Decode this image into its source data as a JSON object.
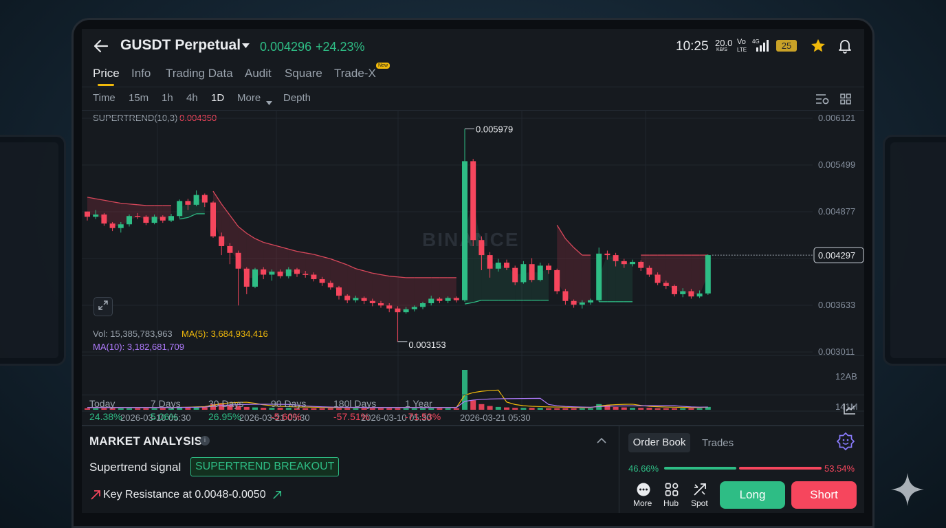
{
  "header": {
    "back_icon": "arrow-left-icon",
    "symbol": "GUSDT Perpetual",
    "price": "0.004296",
    "change": "+24.23%"
  },
  "status_bar": {
    "time": "10:25",
    "net_speed": "20.0",
    "net_unit": "KB/S",
    "volte_top": "Vo",
    "volte_bottom": "LTE",
    "signal": "4G",
    "battery": "25"
  },
  "tabs": [
    {
      "label": "Price",
      "active": true
    },
    {
      "label": "Info"
    },
    {
      "label": "Trading Data"
    },
    {
      "label": "Audit"
    },
    {
      "label": "Square"
    },
    {
      "label": "Trade-X",
      "badge": "New"
    }
  ],
  "intervals": {
    "items": [
      "Time",
      "15m",
      "1h",
      "4h",
      "1D",
      "More",
      "Depth"
    ],
    "active": "1D"
  },
  "indicator": {
    "name": "SUPERTREND(10,3)",
    "value": "0.004350"
  },
  "watermark": "BINANCE",
  "price_axis": [
    "0.006121",
    "0.005499",
    "0.004877",
    "0.004297",
    "0.003633",
    "0.003011"
  ],
  "current_price_label": "0.004297",
  "high_label": "0.005979",
  "low_label": "0.003153",
  "volume": {
    "vol_label": "Vol: 15,385,783,963",
    "ma5_label": "MA(5): 3,684,934,416",
    "ma10_label": "MA(10): 3,182,681,709",
    "axis": [
      "12AB",
      "141M"
    ]
  },
  "date_axis": [
    "2026-03-10 05:30",
    "2026-03-21 05:30",
    "2026-03-10 05:30",
    "2026-03-21 05:30"
  ],
  "performance": [
    {
      "label": "Today",
      "value": "24.38%",
      "dir": "up"
    },
    {
      "label": "7 Days",
      "value": "5.06%",
      "dir": "up"
    },
    {
      "label": "30 Days",
      "value": "26.95%",
      "dir": "up"
    },
    {
      "label": "90 Days",
      "value": "-5.60%",
      "dir": "down"
    },
    {
      "label": "180l Days",
      "value": "-57.51%",
      "dir": "down"
    },
    {
      "label": "1 Year",
      "value": "-71.53%",
      "dir": "down"
    }
  ],
  "market_analysis": {
    "title": "MARKET ANALYSIS",
    "signal_label": "Supertrend signal",
    "signal_badge": "SUPERTREND BREAKOUT",
    "resistance": "Key Resistance at 0.0048-0.0050"
  },
  "order_panel": {
    "tab_orderbook": "Order Book",
    "tab_trades": "Trades",
    "buy_pct": "46.66%",
    "sell_pct": "53.54%",
    "buy_ratio": 0.4666
  },
  "bottom_nav": {
    "more": "More",
    "hub": "Hub",
    "spot": "Spot",
    "long": "Long",
    "short": "Short"
  },
  "colors": {
    "up": "#2ebd85",
    "down": "#f6465d",
    "accent": "#f0b90b",
    "ma5": "#f0b90b",
    "ma10": "#b17cff"
  },
  "chart_data": {
    "type": "candlestick",
    "indicator": "SUPERTREND(10,3)",
    "ylim": [
      0.003011,
      0.006121
    ],
    "candles": [
      [
        0.00488,
        0.00481,
        0.00488,
        0.00476
      ],
      [
        0.00481,
        0.00484,
        0.0049,
        0.00478
      ],
      [
        0.00484,
        0.00472,
        0.00486,
        0.00469
      ],
      [
        0.00472,
        0.00466,
        0.00474,
        0.00462
      ],
      [
        0.00466,
        0.00471,
        0.00474,
        0.0046
      ],
      [
        0.00471,
        0.00482,
        0.00484,
        0.00468
      ],
      [
        0.00482,
        0.00481,
        0.00486,
        0.00478
      ],
      [
        0.00481,
        0.00473,
        0.00483,
        0.0047
      ],
      [
        0.00473,
        0.00481,
        0.00484,
        0.00471
      ],
      [
        0.00481,
        0.00476,
        0.00483,
        0.00473
      ],
      [
        0.00476,
        0.00482,
        0.00485,
        0.00474
      ],
      [
        0.00482,
        0.00502,
        0.00504,
        0.00479
      ],
      [
        0.00502,
        0.00497,
        0.00505,
        0.0049
      ],
      [
        0.00497,
        0.0051,
        0.00516,
        0.00495
      ],
      [
        0.0051,
        0.005,
        0.00512,
        0.00494
      ],
      [
        0.005,
        0.00455,
        0.00502,
        0.00453
      ],
      [
        0.00455,
        0.00442,
        0.0046,
        0.0043
      ],
      [
        0.00442,
        0.00433,
        0.00446,
        0.00418
      ],
      [
        0.00433,
        0.00412,
        0.00436,
        0.00363
      ],
      [
        0.00412,
        0.00388,
        0.00414,
        0.00378
      ],
      [
        0.00388,
        0.00411,
        0.00413,
        0.00386
      ],
      [
        0.00411,
        0.00404,
        0.00414,
        0.00398
      ],
      [
        0.00404,
        0.00408,
        0.00411,
        0.00396
      ],
      [
        0.00408,
        0.00402,
        0.00411,
        0.00399
      ],
      [
        0.00402,
        0.00411,
        0.00414,
        0.00399
      ],
      [
        0.00411,
        0.00405,
        0.00413,
        0.00401
      ],
      [
        0.00405,
        0.00404,
        0.00409,
        0.004
      ],
      [
        0.00404,
        0.00398,
        0.00407,
        0.00395
      ],
      [
        0.00398,
        0.00393,
        0.00401,
        0.00389
      ],
      [
        0.00393,
        0.00387,
        0.00396,
        0.00384
      ],
      [
        0.00387,
        0.00376,
        0.00389,
        0.00371
      ],
      [
        0.00376,
        0.0037,
        0.00378,
        0.00366
      ],
      [
        0.0037,
        0.00373,
        0.00376,
        0.00367
      ],
      [
        0.00373,
        0.00369,
        0.00375,
        0.00365
      ],
      [
        0.00369,
        0.00366,
        0.00372,
        0.00362
      ],
      [
        0.00366,
        0.00363,
        0.00369,
        0.0036
      ],
      [
        0.00363,
        0.00359,
        0.00366,
        0.00354
      ],
      [
        0.00359,
        0.00354,
        0.00362,
        0.00315
      ],
      [
        0.00354,
        0.00358,
        0.00361,
        0.00352
      ],
      [
        0.00358,
        0.00361,
        0.00363,
        0.00355
      ],
      [
        0.00361,
        0.00366,
        0.00368,
        0.00358
      ],
      [
        0.00366,
        0.00372,
        0.00376,
        0.00363
      ],
      [
        0.00372,
        0.00369,
        0.00374,
        0.00366
      ],
      [
        0.00369,
        0.00373,
        0.00375,
        0.00366
      ],
      [
        0.00373,
        0.0037,
        0.00375,
        0.00367
      ],
      [
        0.0037,
        0.00555,
        0.00598,
        0.00368
      ],
      [
        0.00555,
        0.0045,
        0.00558,
        0.00442
      ],
      [
        0.0045,
        0.0043,
        0.00455,
        0.0041
      ],
      [
        0.0043,
        0.00412,
        0.00434,
        0.004
      ],
      [
        0.00412,
        0.0042,
        0.00425,
        0.00408
      ],
      [
        0.0042,
        0.00413,
        0.00424,
        0.0041
      ],
      [
        0.00413,
        0.00394,
        0.00416,
        0.0039
      ],
      [
        0.00394,
        0.00418,
        0.00422,
        0.00392
      ],
      [
        0.00418,
        0.00397,
        0.00426,
        0.00394
      ],
      [
        0.00397,
        0.00416,
        0.0042,
        0.00395
      ],
      [
        0.00416,
        0.0041,
        0.00419,
        0.00405
      ],
      [
        0.0041,
        0.00382,
        0.00412,
        0.00378
      ],
      [
        0.00382,
        0.00369,
        0.00385,
        0.00364
      ],
      [
        0.00369,
        0.00364,
        0.00371,
        0.0036
      ],
      [
        0.00364,
        0.00367,
        0.0037,
        0.00359
      ],
      [
        0.00367,
        0.0037,
        0.00372,
        0.00364
      ],
      [
        0.0037,
        0.00432,
        0.0044,
        0.00368
      ],
      [
        0.00432,
        0.0043,
        0.00436,
        0.00424
      ],
      [
        0.0043,
        0.00422,
        0.00433,
        0.00415
      ],
      [
        0.00422,
        0.00418,
        0.00425,
        0.00413
      ],
      [
        0.00418,
        0.00421,
        0.00424,
        0.00415
      ],
      [
        0.00421,
        0.00413,
        0.00423,
        0.00409
      ],
      [
        0.00413,
        0.00404,
        0.00416,
        0.00401
      ],
      [
        0.00404,
        0.00393,
        0.00407,
        0.0039
      ],
      [
        0.00393,
        0.00389,
        0.00396,
        0.00385
      ],
      [
        0.00389,
        0.00378,
        0.00391,
        0.00375
      ],
      [
        0.00378,
        0.00382,
        0.00386,
        0.00374
      ],
      [
        0.00382,
        0.00375,
        0.00385,
        0.00372
      ],
      [
        0.00375,
        0.00379,
        0.00383,
        0.00373
      ],
      [
        0.00379,
        0.0043,
        0.00431,
        0.00377
      ]
    ],
    "supertrend": [
      0.00507,
      0.00505,
      0.00503,
      0.00501,
      0.00499,
      0.00498,
      0.00497,
      0.00496,
      0.00496,
      0.00496,
      0.00496,
      0.00478,
      0.0048,
      0.00485,
      0.00485,
      0.00515,
      0.00498,
      0.00483,
      0.00468,
      0.00459,
      0.00452,
      0.00447,
      0.00444,
      0.00441,
      0.00438,
      0.00435,
      0.00433,
      0.00431,
      0.00428,
      0.00425,
      0.00421,
      0.00417,
      0.00412,
      0.00409,
      0.00406,
      0.00404,
      0.00402,
      0.00401,
      0.004,
      0.004,
      0.004,
      0.004,
      0.004,
      0.004,
      0.004,
      0.00365,
      0.00367,
      0.0037,
      0.0037,
      0.0037,
      0.0037,
      0.0037,
      0.0037,
      0.0037,
      0.0037,
      0.0037,
      0.0047,
      0.00452,
      0.0044,
      0.0043,
      0.0043,
      0.00368,
      0.00368,
      0.00368,
      0.00368,
      0.00368,
      0.0043,
      0.0043,
      0.0043,
      0.0043,
      0.0043,
      0.0043,
      0.0043,
      0.0043,
      0.0043
    ],
    "supertrend_dir": [
      "down",
      "down",
      "down",
      "down",
      "down",
      "down",
      "down",
      "down",
      "down",
      "down",
      "down",
      "up",
      "up",
      "up",
      "up",
      "down",
      "down",
      "down",
      "down",
      "down",
      "down",
      "down",
      "down",
      "down",
      "down",
      "down",
      "down",
      "down",
      "down",
      "down",
      "down",
      "down",
      "down",
      "down",
      "down",
      "down",
      "down",
      "down",
      "down",
      "down",
      "down",
      "down",
      "down",
      "down",
      "down",
      "up",
      "up",
      "up",
      "up",
      "up",
      "up",
      "up",
      "up",
      "up",
      "up",
      "up",
      "down",
      "down",
      "down",
      "down",
      "down",
      "up",
      "up",
      "up",
      "up",
      "up",
      "down",
      "down",
      "down",
      "down",
      "down",
      "down",
      "down",
      "down",
      "down"
    ],
    "volume": [
      3,
      3,
      3,
      3,
      3,
      3,
      3,
      3,
      3,
      3,
      3,
      4,
      4,
      5,
      5,
      12,
      14,
      10,
      8,
      6,
      5,
      4,
      4,
      4,
      4,
      3,
      3,
      3,
      3,
      3,
      3,
      3,
      3,
      3,
      3,
      3,
      3,
      3,
      3,
      3,
      3,
      3,
      3,
      3,
      3,
      85,
      20,
      12,
      8,
      6,
      5,
      4,
      4,
      4,
      4,
      3,
      3,
      3,
      3,
      3,
      3,
      12,
      10,
      6,
      5,
      4,
      4,
      4,
      3,
      3,
      3,
      3,
      3,
      3,
      6
    ]
  }
}
